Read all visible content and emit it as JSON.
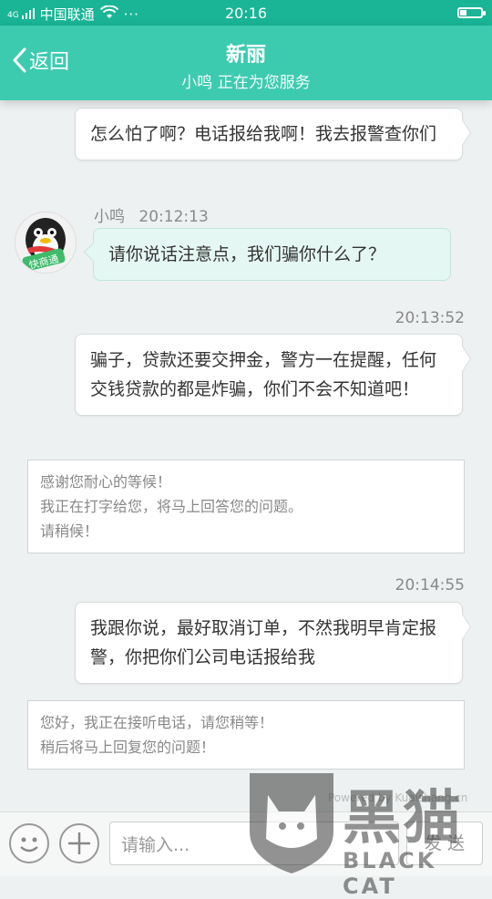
{
  "status_bar": {
    "carrier": "中国联通",
    "signal_text": "4G",
    "time": "20:16",
    "battery_level": 0.3
  },
  "nav": {
    "back_label": "返回",
    "title": "新丽",
    "subtitle": "小鸣 正在为您服务"
  },
  "messages": {
    "m1": "怎么怕了啊？电话报给我啊！我去报警查你们",
    "agent_name": "小鸣",
    "agent_time": "20:12:13",
    "m2": "请你说话注意点，我们骗你什么了？",
    "t3": "20:13:52",
    "m3": "骗子，贷款还要交押金，警方一在提醒，任何交钱贷款的都是炸骗，你们不会不知道吧！",
    "notice1": [
      "感谢您耐心的等候！",
      "我正在打字给您，将马上回答您的问题。",
      "请稍候！"
    ],
    "t4": "20:14:55",
    "m4": "我跟你说，最好取消订单，不然我明早肯定报警，你把你们公司电话报给我",
    "notice2": [
      "您好，我正在接听电话，请您稍等！",
      "稍后将马上回复您的问题！"
    ]
  },
  "input": {
    "placeholder": "请输入...",
    "send_label": "发 送",
    "powered_text": "Powered by Kuaishang.cn"
  },
  "watermark": {
    "cn": "黑猫",
    "en": "BLACK CAT"
  },
  "colors": {
    "status_bar": "#19b596",
    "nav_bar": "#3dcbb0",
    "agent_bubble": "#e5f7f2"
  },
  "icons": [
    "wifi-icon",
    "back-chevron-icon",
    "battery-icon",
    "emoji-icon",
    "plus-icon",
    "cat-watermark-icon"
  ]
}
